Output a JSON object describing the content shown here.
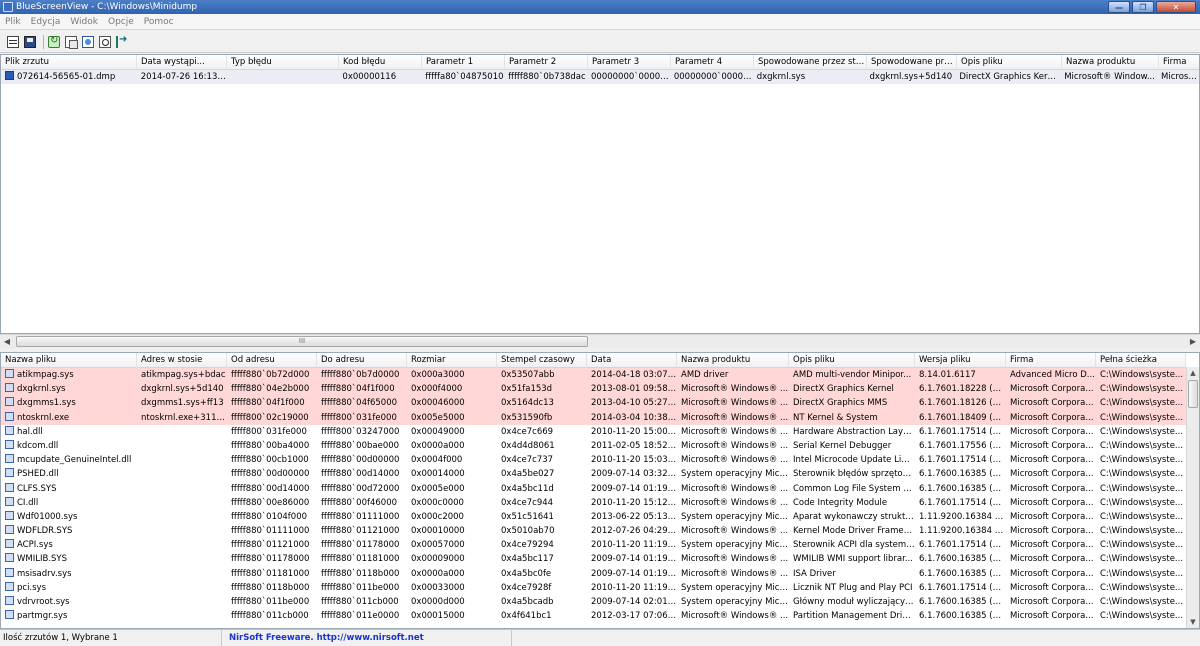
{
  "window": {
    "title": "BlueScreenView  -  C:\\Windows\\Minidump",
    "minimize": "—",
    "maximize": "❐",
    "close": "✕"
  },
  "menu": [
    "Plik",
    "Edycja",
    "Widok",
    "Opcje",
    "Pomoc"
  ],
  "toolbar": {
    "icons": [
      "properties-icon",
      "save-icon",
      "refresh-icon",
      "copy-icon",
      "html-report-icon",
      "find-icon",
      "exit-icon"
    ]
  },
  "dump_list": {
    "columns": [
      "Plik zrzutu",
      "Data wystąpi...",
      "Typ błędu",
      "Kod błędu",
      "Parametr 1",
      "Parametr 2",
      "Parametr 3",
      "Parametr 4",
      "Spowodowane przez ste...",
      "Spowodowane prz...",
      "Opis pliku",
      "Nazwa produktu",
      "Firma"
    ],
    "sort_indicator": "▽",
    "rows": [
      [
        "072614-56565-01.dmp",
        "2014-07-26 16:13:38",
        "",
        "0x00000116",
        "fffffa80`04875010",
        "fffff880`0b738dac",
        "00000000`000000...",
        "00000000`000000...",
        "dxgkrnl.sys",
        "dxgkrnl.sys+5d140",
        "DirectX Graphics Kernel",
        "Microsoft® Window...",
        "Microsoft"
      ]
    ],
    "scroll_grip": "III"
  },
  "driver_list": {
    "columns": [
      "Nazwa pliku",
      "Adres w stosie",
      "Od adresu",
      "Do adresu",
      "Rozmiar",
      "Stempel czasowy",
      "Data",
      "Nazwa produktu",
      "Opis pliku",
      "Wersja pliku",
      "Firma",
      "Pełna ścieżka"
    ],
    "sort_indicator": "/",
    "rows": [
      [
        "atikmpag.sys",
        "atikmpag.sys+bdac",
        "fffff880`0b72d000",
        "fffff880`0b7d0000",
        "0x000a3000",
        "0x53507abb",
        "2014-04-18 03:07:07",
        "AMD driver",
        "AMD multi-vendor Minipor...",
        "8.14.01.6117",
        "Advanced Micro D...",
        "C:\\Windows\\syste..."
      ],
      [
        "dxgkrnl.sys",
        "dxgkrnl.sys+5d140",
        "fffff880`04e2b000",
        "fffff880`04f1f000",
        "0x000f4000",
        "0x51fa153d",
        "2013-08-01 09:58:53",
        "Microsoft® Windows® ...",
        "DirectX Graphics Kernel",
        "6.1.7601.18228 (wi...",
        "Microsoft Corpora...",
        "C:\\Windows\\syste..."
      ],
      [
        "dxgmms1.sys",
        "dxgmms1.sys+ff13",
        "fffff880`04f1f000",
        "fffff880`04f65000",
        "0x00046000",
        "0x5164dc13",
        "2013-04-10 05:27:15",
        "Microsoft® Windows® ...",
        "DirectX Graphics MMS",
        "6.1.7601.18126 (wi...",
        "Microsoft Corpora...",
        "C:\\Windows\\syste..."
      ],
      [
        "ntoskrnl.exe",
        "ntoskrnl.exe+31173a",
        "fffff800`02c19000",
        "fffff800`031fe000",
        "0x005e5000",
        "0x531590fb",
        "2014-03-04 10:38:19",
        "Microsoft® Windows® ...",
        "NT Kernel & System",
        "6.1.7601.18409 (wi...",
        "Microsoft Corpora...",
        "C:\\Windows\\syste..."
      ],
      [
        "hal.dll",
        "",
        "fffff800`031fe000",
        "fffff800`03247000",
        "0x00049000",
        "0x4ce7c669",
        "2010-11-20 15:00:25",
        "Microsoft® Windows® ...",
        "Hardware Abstraction Layer...",
        "6.1.7601.17514 (wi...",
        "Microsoft Corpora...",
        "C:\\Windows\\syste..."
      ],
      [
        "kdcom.dll",
        "",
        "fffff880`00ba4000",
        "fffff880`00bae000",
        "0x0000a000",
        "0x4d4d8061",
        "2011-02-05 18:52:49",
        "Microsoft® Windows® ...",
        "Serial Kernel Debugger",
        "6.1.7601.17556 (wi...",
        "Microsoft Corpora...",
        "C:\\Windows\\syste..."
      ],
      [
        "mcupdate_GenuineIntel.dll",
        "",
        "fffff880`00cb1000",
        "fffff880`00d00000",
        "0x0004f000",
        "0x4ce7c737",
        "2010-11-20 15:03:51",
        "Microsoft® Windows® ...",
        "Intel Microcode Update Libr...",
        "6.1.7601.17514 (wi...",
        "Microsoft Corpora...",
        "C:\\Windows\\syste..."
      ],
      [
        "PSHED.dll",
        "",
        "fffff880`00d00000",
        "fffff880`00d14000",
        "0x00014000",
        "0x4a5be027",
        "2009-07-14 03:32:23",
        "System operacyjny Micr...",
        "Sterownik błędów sprzętow...",
        "6.1.7600.16385 (wi...",
        "Microsoft Corpora...",
        "C:\\Windows\\syste..."
      ],
      [
        "CLFS.SYS",
        "",
        "fffff880`00d14000",
        "fffff880`00d72000",
        "0x0005e000",
        "0x4a5bc11d",
        "2009-07-14 01:19:57",
        "Microsoft® Windows® ...",
        "Common Log File System D...",
        "6.1.7600.16385 (wi...",
        "Microsoft Corpora...",
        "C:\\Windows\\syste..."
      ],
      [
        "CI.dll",
        "",
        "fffff880`00e86000",
        "fffff880`00f46000",
        "0x000c0000",
        "0x4ce7c944",
        "2010-11-20 15:12:36",
        "Microsoft® Windows® ...",
        "Code Integrity Module",
        "6.1.7601.17514 (wi...",
        "Microsoft Corpora...",
        "C:\\Windows\\syste..."
      ],
      [
        "Wdf01000.sys",
        "",
        "fffff880`0104f000",
        "fffff880`01111000",
        "0x000c2000",
        "0x51c51641",
        "2013-06-22 05:13:05",
        "System operacyjny Micr...",
        "Aparat wykonawczy struktu...",
        "1.11.9200.16384 (w...",
        "Microsoft Corpora...",
        "C:\\Windows\\syste..."
      ],
      [
        "WDFLDR.SYS",
        "",
        "fffff880`01111000",
        "fffff880`01121000",
        "0x00010000",
        "0x5010ab70",
        "2012-07-26 04:29:04",
        "Microsoft® Windows® ...",
        "Kernel Mode Driver Framew...",
        "1.11.9200.16384 (w...",
        "Microsoft Corpora...",
        "C:\\Windows\\syste..."
      ],
      [
        "ACPI.sys",
        "",
        "fffff880`01121000",
        "fffff880`01178000",
        "0x00057000",
        "0x4ce79294",
        "2010-11-20 11:19:16",
        "System operacyjny Micr...",
        "Sterownik ACPI dla systemu...",
        "6.1.7601.17514 (wi...",
        "Microsoft Corpora...",
        "C:\\Windows\\syste..."
      ],
      [
        "WMILIB.SYS",
        "",
        "fffff880`01178000",
        "fffff880`01181000",
        "0x00009000",
        "0x4a5bc117",
        "2009-07-14 01:19:51",
        "Microsoft® Windows® ...",
        "WMILIB WMI support librar...",
        "6.1.7600.16385 (wi...",
        "Microsoft Corpora...",
        "C:\\Windows\\syste..."
      ],
      [
        "msisadrv.sys",
        "",
        "fffff880`01181000",
        "fffff880`0118b000",
        "0x0000a000",
        "0x4a5bc0fe",
        "2009-07-14 01:19:26",
        "Microsoft® Windows® ...",
        "ISA Driver",
        "6.1.7600.16385 (wi...",
        "Microsoft Corpora...",
        "C:\\Windows\\syste..."
      ],
      [
        "pci.sys",
        "",
        "fffff880`0118b000",
        "fffff880`011be000",
        "0x00033000",
        "0x4ce7928f",
        "2010-11-20 11:19:11",
        "System operacyjny Micr...",
        "Licznik NT Plug and Play PCI",
        "6.1.7601.17514 (wi...",
        "Microsoft Corpora...",
        "C:\\Windows\\syste..."
      ],
      [
        "vdrvroot.sys",
        "",
        "fffff880`011be000",
        "fffff880`011cb000",
        "0x0000d000",
        "0x4a5bcadb",
        "2009-07-14 02:01:31",
        "System operacyjny Micr...",
        "Główny moduł wyliczający ...",
        "6.1.7600.16385 (wi...",
        "Microsoft Corpora...",
        "C:\\Windows\\syste..."
      ],
      [
        "partmgr.sys",
        "",
        "fffff880`011cb000",
        "fffff880`011e0000",
        "0x00015000",
        "0x4f641bc1",
        "2012-03-17 07:06:09",
        "Microsoft® Windows® ...",
        "Partition Management Driver",
        "6.1.7600.16385 (wi...",
        "Microsoft Corpora...",
        "C:\\Windows\\syste..."
      ]
    ],
    "highlighted_rows": 4
  },
  "status": {
    "count_text": "Ilość zrzutów 1, Wybrane 1",
    "nirsoft_text": "NirSoft Freeware.  http://www.nirsoft.net"
  }
}
